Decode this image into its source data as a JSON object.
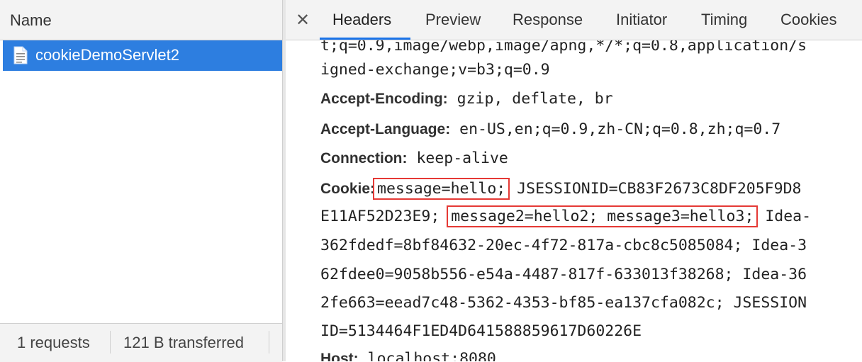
{
  "left_panel": {
    "column_header": "Name",
    "selected_request": "cookieDemoServlet2",
    "footer": {
      "requests": "1 requests",
      "transferred": "121 B transferred"
    }
  },
  "tabs": {
    "items": [
      "Headers",
      "Preview",
      "Response",
      "Initiator",
      "Timing",
      "Cookies"
    ],
    "active": "Headers"
  },
  "headers": {
    "line0": "t;q=0.9,image/webp,image/apng,*/*;q=0.8,application/s",
    "line1": "igned-exchange;v=b3;q=0.9",
    "accept_encoding": {
      "key": "Accept-Encoding:",
      "value": "gzip, deflate, br"
    },
    "accept_language": {
      "key": "Accept-Language:",
      "value": "en-US,en;q=0.9,zh-CN;q=0.8,zh;q=0.7"
    },
    "connection": {
      "key": "Connection:",
      "value": "keep-alive"
    },
    "cookie": {
      "key": "Cookie:",
      "hl1": "message=hello;",
      "rest1": "JSESSIONID=CB83F2673C8DF205F9D8",
      "pre2": "E11AF52D23E9;",
      "hl2": "message2=hello2; message3=hello3;",
      "rest2": "Idea-",
      "line3": "362fdedf=8bf84632-20ec-4f72-817a-cbc8c5085084; Idea-3",
      "line4": "62fdee0=9058b556-e54a-4487-817f-633013f38268; Idea-36",
      "line5": "2fe663=eead7c48-5362-4353-bf85-ea137cfa082c; JSESSION",
      "line6": "ID=5134464F1ED4D641588859617D60226E"
    },
    "host": {
      "key": "Host:",
      "value": "localhost:8080"
    }
  },
  "colors": {
    "selection": "#2d7ee0",
    "highlight_box": "#e53935",
    "active_tab_underline": "#1a73e8"
  }
}
